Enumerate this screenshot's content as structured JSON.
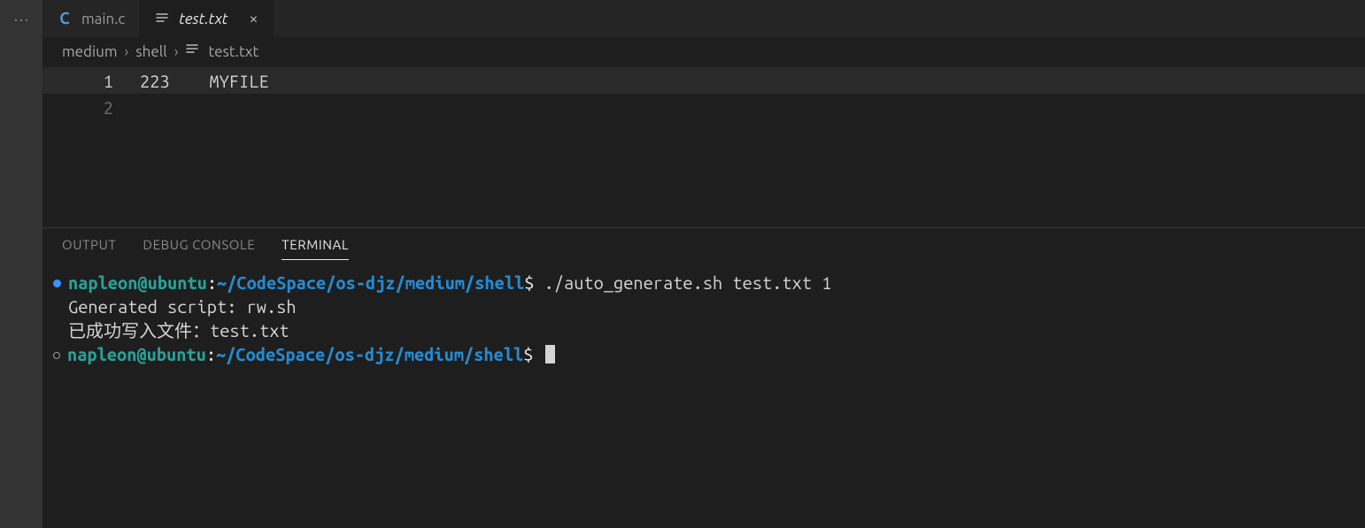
{
  "tabs": [
    {
      "label": "main.c",
      "icon": "c-file-icon",
      "active": false
    },
    {
      "label": "test.txt",
      "icon": "text-file-icon",
      "active": true
    }
  ],
  "breadcrumb": {
    "seg0": "medium",
    "seg1": "shell",
    "file": "test.txt"
  },
  "editor": {
    "lines": [
      {
        "num": "1",
        "text": "223    MYFILE"
      },
      {
        "num": "2",
        "text": ""
      }
    ]
  },
  "panel": {
    "tabs": {
      "output": "OUTPUT",
      "debug": "DEBUG CONSOLE",
      "terminal": "TERMINAL"
    }
  },
  "terminal": {
    "prompt": {
      "user": "napleon@ubuntu",
      "sep": ":",
      "path": "~/CodeSpace/os-djz/medium/shell",
      "sym": "$"
    },
    "cmd1": " ./auto_generate.sh test.txt 1",
    "out1": "Generated script: rw.sh",
    "out2": "已成功写入文件：test.txt",
    "cmd2": " "
  }
}
